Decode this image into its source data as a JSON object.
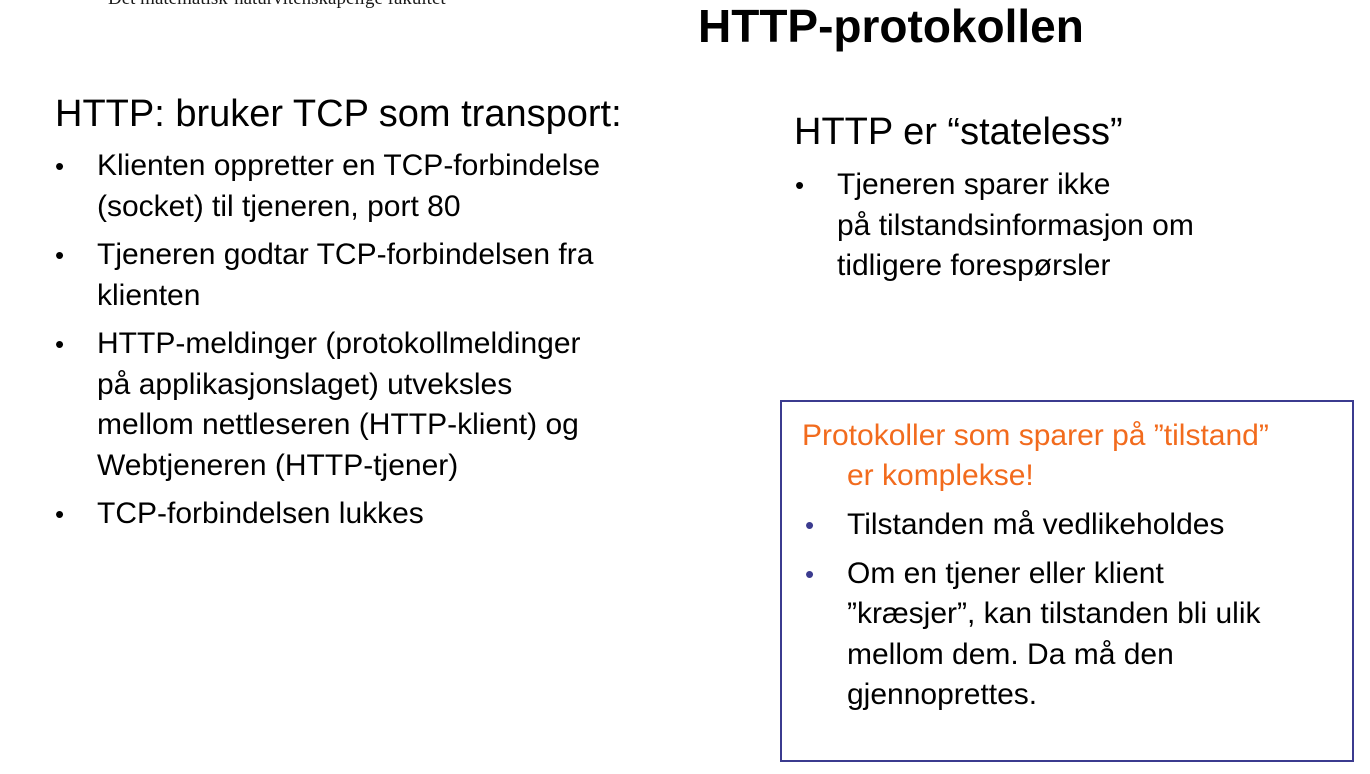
{
  "header": {
    "faculty": "Det matematisk-naturvitenskapelige fakultet",
    "title": "HTTP-protokollen"
  },
  "left": {
    "heading": "HTTP: bruker TCP som transport:",
    "bullets": [
      {
        "lines": [
          "Klienten oppretter en TCP-forbindelse",
          "(socket) til tjeneren, port 80"
        ]
      },
      {
        "lines": [
          "Tjeneren godtar TCP-forbindelsen fra",
          "klienten"
        ]
      },
      {
        "lines": [
          "HTTP-meldinger (protokollmeldinger",
          "på applikasjonslaget) utveksles",
          "mellom nettleseren (HTTP-klient) og",
          "Webtjeneren (HTTP-tjener)"
        ]
      },
      {
        "lines": [
          "TCP-forbindelsen lukkes"
        ]
      }
    ]
  },
  "right": {
    "heading": "HTTP er “stateless”",
    "bullets": [
      {
        "lines": [
          "Tjeneren sparer ikke",
          "på tilstandsinformasjon om",
          "tidligere forespørsler"
        ]
      }
    ]
  },
  "box": {
    "heading_lines": [
      "Protokoller som sparer på ”tilstand”",
      "er komplekse!"
    ],
    "bullets": [
      {
        "lines": [
          "Tilstanden må vedlikeholdes"
        ]
      },
      {
        "lines": [
          "Om en tjener eller klient",
          "”kræsjer”, kan tilstanden bli ulik",
          "mellom dem. Da må den",
          "gjennoprettes."
        ]
      }
    ]
  },
  "colors": {
    "accent_orange": "#f26b1d",
    "box_border": "#3b3b8f"
  }
}
